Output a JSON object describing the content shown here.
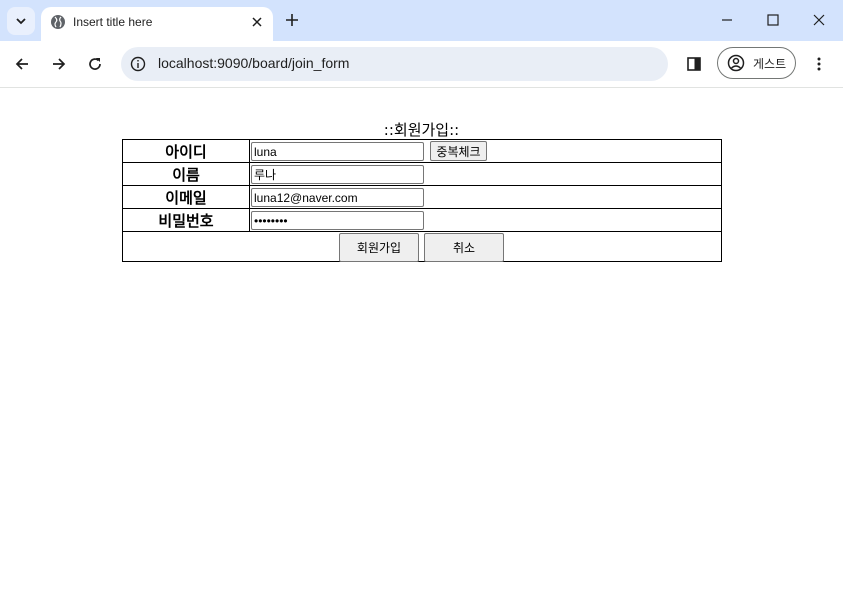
{
  "browser": {
    "tab": {
      "title": "Insert title here"
    },
    "address_bar": {
      "url": "localhost:9090/board/join_form"
    },
    "profile": {
      "label": "게스트"
    },
    "icons": [
      "tab-search-icon",
      "globe-icon",
      "close-icon",
      "plus-icon",
      "minimize-icon",
      "maximize-icon",
      "window-close-icon",
      "back-icon",
      "forward-icon",
      "reload-icon",
      "info-icon",
      "side-panel-icon",
      "profile-icon",
      "more-vert-icon"
    ]
  },
  "page": {
    "caption": "::회원가입::",
    "form": {
      "id": {
        "label": "아이디",
        "value": "luna"
      },
      "name": {
        "label": "이름",
        "value": "루나"
      },
      "email": {
        "label": "이메일",
        "value": "luna12@naver.com"
      },
      "password": {
        "label": "비밀번호",
        "value": "••••••••"
      },
      "duplicate_check_label": "중복체크",
      "submit_label": "회원가입",
      "cancel_label": "취소"
    }
  },
  "colors": {
    "tabstrip": "#d3e3fd",
    "omnibox": "#e9eef6",
    "button": "#efefef"
  }
}
